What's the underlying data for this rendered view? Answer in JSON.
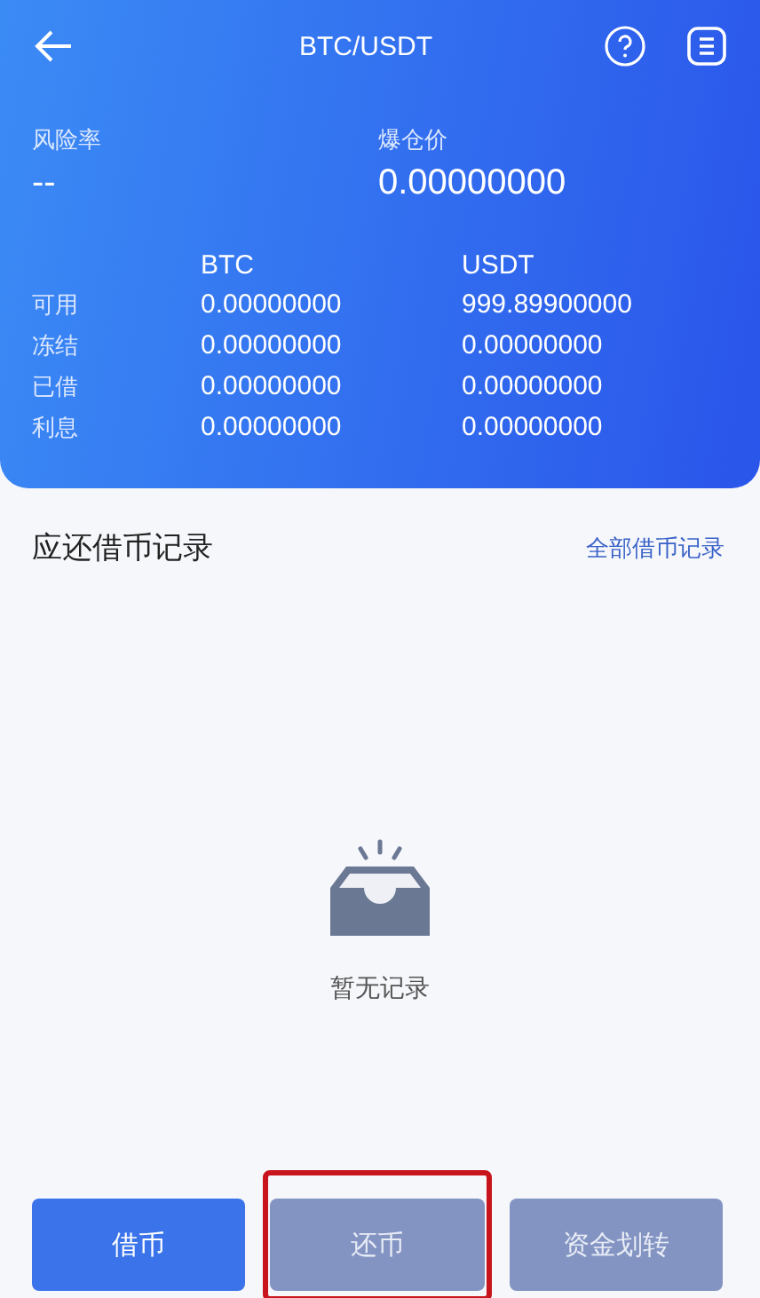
{
  "header": {
    "title": "BTC/USDT"
  },
  "risk": {
    "label": "风险率",
    "value": "--"
  },
  "liquidation": {
    "label": "爆仓价",
    "value": "0.00000000"
  },
  "balances": {
    "columns": [
      "BTC",
      "USDT"
    ],
    "rows": [
      {
        "label": "可用",
        "values": [
          "0.00000000",
          "999.89900000"
        ]
      },
      {
        "label": "冻结",
        "values": [
          "0.00000000",
          "0.00000000"
        ]
      },
      {
        "label": "已借",
        "values": [
          "0.00000000",
          "0.00000000"
        ]
      },
      {
        "label": "利息",
        "values": [
          "0.00000000",
          "0.00000000"
        ]
      }
    ]
  },
  "records": {
    "title": "应还借币记录",
    "link": "全部借币记录",
    "empty_text": "暂无记录"
  },
  "buttons": [
    {
      "label": "借币",
      "disabled": false,
      "highlighted": false
    },
    {
      "label": "还币",
      "disabled": true,
      "highlighted": true
    },
    {
      "label": "资金划转",
      "disabled": true,
      "highlighted": false
    }
  ]
}
